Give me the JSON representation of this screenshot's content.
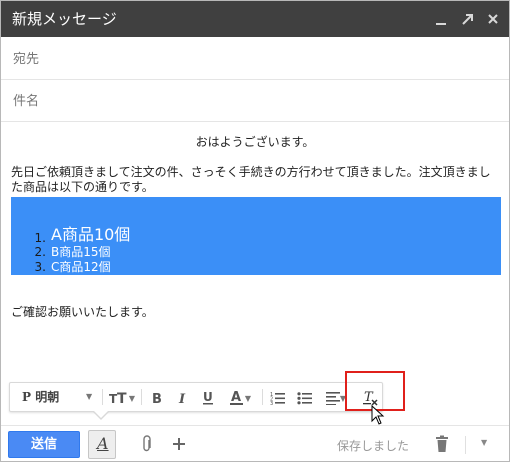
{
  "window": {
    "title": "新規メッセージ",
    "controls": [
      "minimize-icon",
      "expand-icon",
      "close-icon"
    ]
  },
  "fields": {
    "to_placeholder": "宛先",
    "subject_placeholder": "件名"
  },
  "body": {
    "greeting": "おはようございます。",
    "intro": "先日ご依頼頂きまして注文の件、さっそく手続きの方行わせて頂きました。注文頂きました商品は以下の通りです。",
    "items": [
      {
        "num": "1.",
        "text": "A商品10個"
      },
      {
        "num": "2.",
        "text": "B商品15個"
      },
      {
        "num": "3.",
        "text": "C商品12個"
      }
    ],
    "closing": "ご確認お願いいたします。"
  },
  "toolbar": {
    "font_label": "P 明朝",
    "buttons": [
      "font-family",
      "font-size-icon",
      "bold-icon",
      "italic-icon",
      "underline-icon",
      "text-color-icon",
      "numbered-list-icon",
      "bulleted-list-icon",
      "align-icon",
      "remove-formatting-icon"
    ]
  },
  "bottom": {
    "send_label": "送信",
    "saved_text": "保存しました"
  },
  "colors": {
    "titlebar": "#404040",
    "send": "#4a8af4",
    "selection": "#3b8ff7",
    "highlight": "#e0201b"
  }
}
